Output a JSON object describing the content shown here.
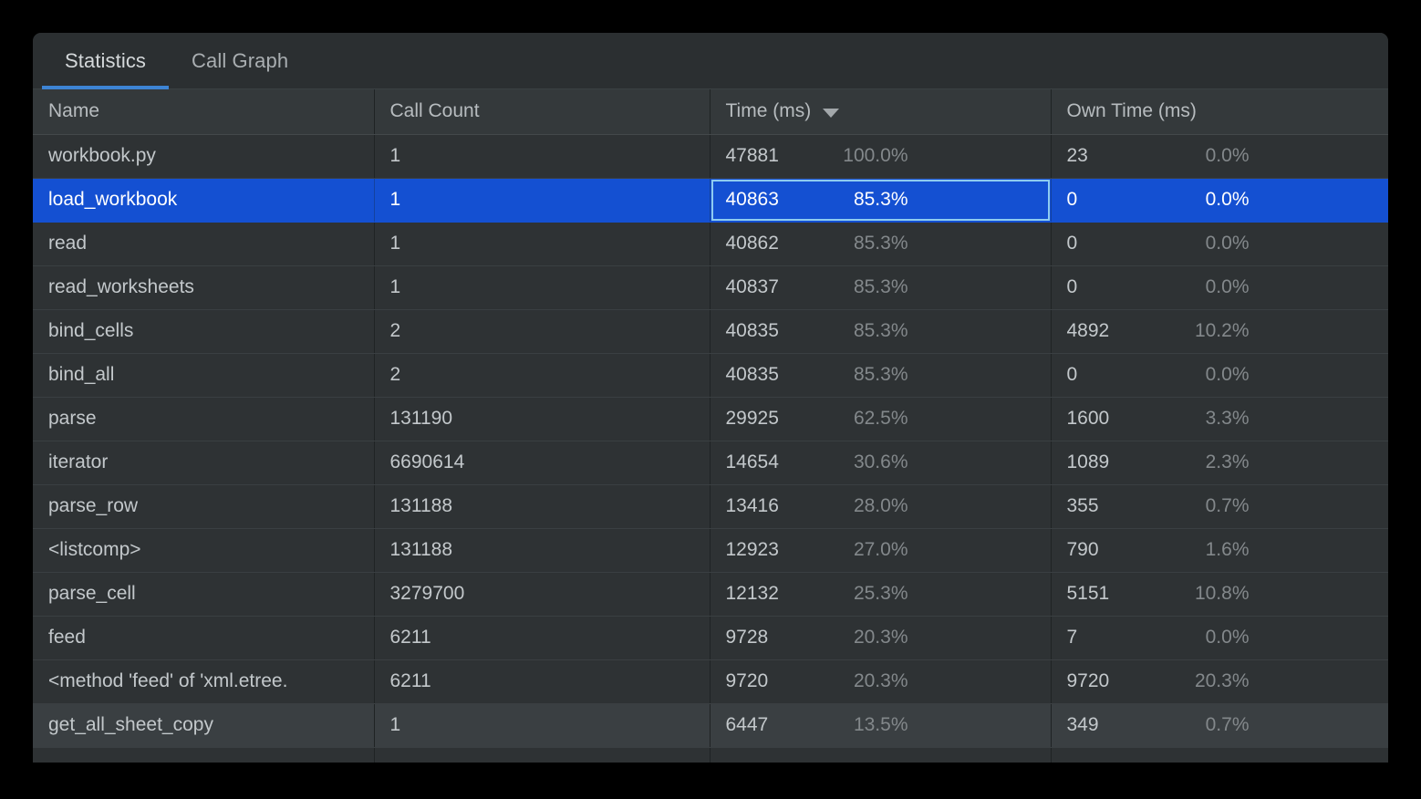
{
  "panel": {
    "tabs": [
      {
        "label": "Statistics",
        "active": true
      },
      {
        "label": "Call Graph",
        "active": false
      }
    ]
  },
  "table": {
    "columns": [
      {
        "key": "name",
        "label": "Name",
        "sorted": false
      },
      {
        "key": "calls",
        "label": "Call Count",
        "sorted": false
      },
      {
        "key": "time",
        "label": "Time (ms)",
        "sorted": true,
        "sort_icon": "caret-down-icon",
        "sort_dir": "desc"
      },
      {
        "key": "own",
        "label": "Own Time (ms)",
        "sorted": false
      }
    ],
    "rows": [
      {
        "name": "workbook.py",
        "calls": "1",
        "time": "47881",
        "time_pct": "100.0%",
        "own": "23",
        "own_pct": "0.0%",
        "selected": false,
        "hovered": false
      },
      {
        "name": "load_workbook",
        "calls": "1",
        "time": "40863",
        "time_pct": "85.3%",
        "own": "0",
        "own_pct": "0.0%",
        "selected": true,
        "hovered": false,
        "focused_cell": "time"
      },
      {
        "name": "read",
        "calls": "1",
        "time": "40862",
        "time_pct": "85.3%",
        "own": "0",
        "own_pct": "0.0%",
        "selected": false,
        "hovered": false
      },
      {
        "name": "read_worksheets",
        "calls": "1",
        "time": "40837",
        "time_pct": "85.3%",
        "own": "0",
        "own_pct": "0.0%",
        "selected": false,
        "hovered": false
      },
      {
        "name": "bind_cells",
        "calls": "2",
        "time": "40835",
        "time_pct": "85.3%",
        "own": "4892",
        "own_pct": "10.2%",
        "selected": false,
        "hovered": false
      },
      {
        "name": "bind_all",
        "calls": "2",
        "time": "40835",
        "time_pct": "85.3%",
        "own": "0",
        "own_pct": "0.0%",
        "selected": false,
        "hovered": false
      },
      {
        "name": "parse",
        "calls": "131190",
        "time": "29925",
        "time_pct": "62.5%",
        "own": "1600",
        "own_pct": "3.3%",
        "selected": false,
        "hovered": false
      },
      {
        "name": "iterator",
        "calls": "6690614",
        "time": "14654",
        "time_pct": "30.6%",
        "own": "1089",
        "own_pct": "2.3%",
        "selected": false,
        "hovered": false
      },
      {
        "name": "parse_row",
        "calls": "131188",
        "time": "13416",
        "time_pct": "28.0%",
        "own": "355",
        "own_pct": "0.7%",
        "selected": false,
        "hovered": false
      },
      {
        "name": "<listcomp>",
        "calls": "131188",
        "time": "12923",
        "time_pct": "27.0%",
        "own": "790",
        "own_pct": "1.6%",
        "selected": false,
        "hovered": false
      },
      {
        "name": "parse_cell",
        "calls": "3279700",
        "time": "12132",
        "time_pct": "25.3%",
        "own": "5151",
        "own_pct": "10.8%",
        "selected": false,
        "hovered": false
      },
      {
        "name": "feed",
        "calls": "6211",
        "time": "9728",
        "time_pct": "20.3%",
        "own": "7",
        "own_pct": "0.0%",
        "selected": false,
        "hovered": false
      },
      {
        "name": "<method 'feed' of 'xml.etree.",
        "calls": "6211",
        "time": "9720",
        "time_pct": "20.3%",
        "own": "9720",
        "own_pct": "20.3%",
        "selected": false,
        "hovered": false
      },
      {
        "name": "get_all_sheet_copy",
        "calls": "1",
        "time": "6447",
        "time_pct": "13.5%",
        "own": "349",
        "own_pct": "0.7%",
        "selected": false,
        "hovered": true
      },
      {
        "name": "",
        "calls": "",
        "time": "",
        "time_pct": "",
        "own": "",
        "own_pct": "",
        "selected": false,
        "hovered": false
      }
    ]
  },
  "colors": {
    "panel_bg": "#2b2f31",
    "row_bg": "#2e3234",
    "header_bg": "#34393b",
    "selection": "#1450d2",
    "tab_accent": "#3d84d4",
    "focus_ring": "#8ecbf0",
    "text": "#c3c8cb",
    "muted_text": "#83888b"
  }
}
